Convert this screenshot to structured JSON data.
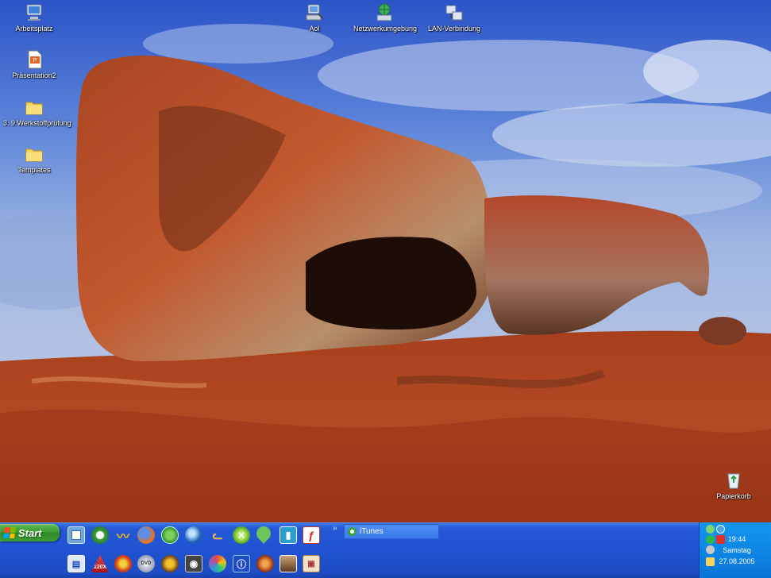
{
  "desktop": {
    "icons": [
      {
        "label": "Arbeitsplatz",
        "icon": "my-computer-icon"
      },
      {
        "label": "Präsentation2",
        "icon": "powerpoint-document-icon"
      },
      {
        "label": "3. 9 Werkstoffprüfung",
        "icon": "folder-icon"
      },
      {
        "label": "Templates",
        "icon": "folder-icon"
      },
      {
        "label": "Aol",
        "icon": "aol-network-icon"
      },
      {
        "label": "Netzwerkumgebung",
        "icon": "network-places-icon"
      },
      {
        "label": "LAN-Verbindung",
        "icon": "lan-connection-icon"
      },
      {
        "label": "Papierkorb",
        "icon": "recycle-bin-icon"
      }
    ]
  },
  "taskbar": {
    "start_label": "Start",
    "quicklaunch": [
      "show-desktop-icon",
      "itunes-icon",
      "messenger-icon",
      "firefox-icon",
      "globe-browser-icon",
      "google-earth-icon",
      "winamp-icon",
      "xbox-icon",
      "pin-icon",
      "contacts-icon",
      "acrobat-icon",
      "media-player-icon",
      "toolbox-icon",
      "media-center-icon",
      "dvd-icon",
      "badge-icon",
      "camera-icon",
      "picasa-icon",
      "info-icon",
      "compass-icon",
      "portrait-icon",
      "document-viewer-icon"
    ],
    "quicklaunch_labels": {
      "xbox_text": "120X",
      "dvd_text": "DVD"
    },
    "chevron": "»",
    "tasks": [
      {
        "label": "iTunes",
        "icon": "itunes-icon"
      }
    ]
  },
  "tray": {
    "time": "19:44",
    "day": "Samstag",
    "date": "27.08.2005",
    "icons": [
      "network-tray-icon",
      "messenger-tray-icon",
      "security-tray-icon",
      "antivirus-tray-icon",
      "volume-tray-icon",
      "folder-tray-icon"
    ]
  },
  "colors": {
    "taskbar": "#2053d2",
    "start_green": "#3c9b31",
    "tray": "#0e86e6",
    "sky": "#4a73d3",
    "rock": "#b8431f"
  }
}
